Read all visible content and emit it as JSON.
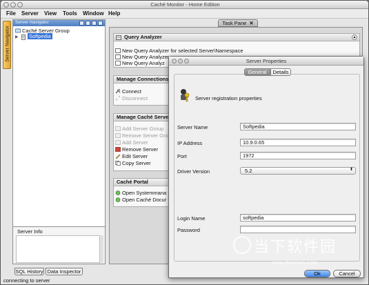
{
  "window": {
    "title": "Caché Monitor - Home Edition"
  },
  "menu": [
    "File",
    "Server",
    "View",
    "Tools",
    "Window",
    "Help"
  ],
  "side_tab": "Server Navigator",
  "navigator": {
    "header": "Server Navigator",
    "tree": [
      {
        "label": "Caché Server Group",
        "icon": "server-group-icon"
      },
      {
        "label": "Softpedia",
        "icon": "server-icon",
        "selected": true
      }
    ]
  },
  "server_info": {
    "label": "Server Info"
  },
  "bottom_tabs": [
    "SQL History",
    "Data Inspector"
  ],
  "status": "connecting to server",
  "task_pane": {
    "tab_label": "Task Pane",
    "close_glyph": "✕",
    "sections": [
      {
        "title": "Query Analyzer",
        "items": [
          {
            "label": "New Query Analyzer for selected Server\\Namespace",
            "enabled": true
          },
          {
            "label": "New Query Analyzer",
            "enabled": true
          },
          {
            "label": "New Query Analyz",
            "enabled": true
          }
        ]
      },
      {
        "title": "Manage Connections",
        "items": [
          {
            "label": "Connect",
            "enabled": true
          },
          {
            "label": "Disconnect",
            "enabled": false
          }
        ]
      },
      {
        "title": "Manage Caché Serve",
        "items": [
          {
            "label": "Add Server Group",
            "enabled": false
          },
          {
            "label": "Remove Server Grou",
            "enabled": false
          },
          {
            "label": "Add Server",
            "enabled": false
          },
          {
            "label": "Remove Server",
            "enabled": true
          },
          {
            "label": "Edit Server",
            "enabled": true
          },
          {
            "label": "Copy Server",
            "enabled": true
          }
        ]
      },
      {
        "title": "Caché Portal",
        "items": [
          {
            "label": "Open Systemmana",
            "enabled": true
          },
          {
            "label": "Open Caché Docur",
            "enabled": true
          }
        ]
      }
    ]
  },
  "dialog": {
    "title": "Server Properties",
    "tabs": {
      "general": "General",
      "details": "Details"
    },
    "heading": "Server registration properties",
    "fields": {
      "server_name": {
        "label": "Server Name",
        "value": "Softpedia"
      },
      "ip_address": {
        "label": "IP Address",
        "value": "10.9.0.65"
      },
      "port": {
        "label": "Port",
        "value": "1972"
      },
      "driver_version": {
        "label": "Driver Version",
        "value": "5.2"
      },
      "login_name": {
        "label": "Login Name",
        "value": "softpedia"
      },
      "password": {
        "label": "Password",
        "value": ""
      }
    },
    "buttons": {
      "ok": "Ok",
      "cancel": "Cancel"
    }
  },
  "watermark": {
    "text": "当下软件园",
    "url": "www.downxia.com"
  },
  "colors": {
    "accent": "#3f86e6",
    "nav_header": "#4f7ec2",
    "tab_orange": "#e8a52c"
  }
}
